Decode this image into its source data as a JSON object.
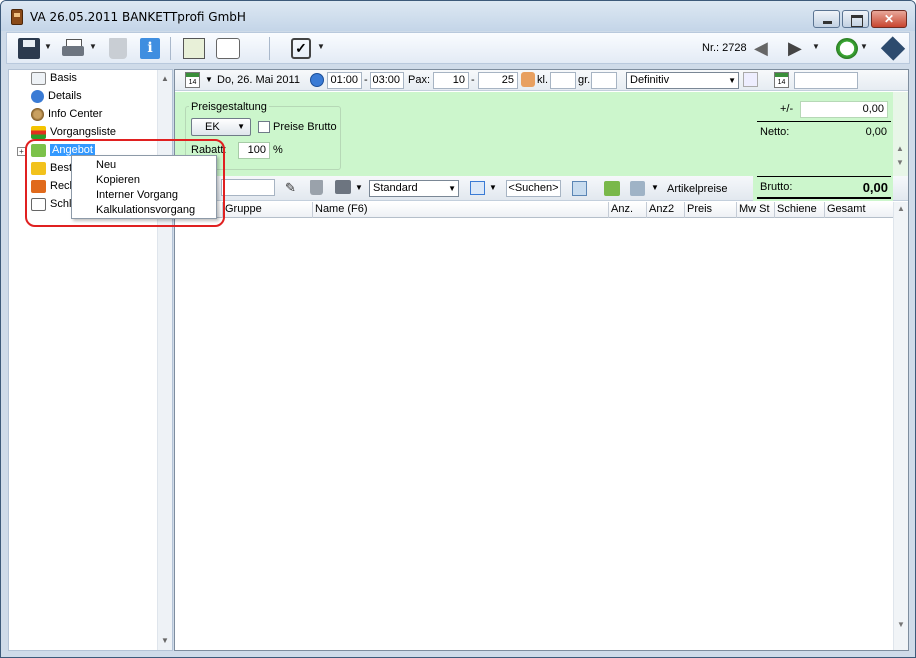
{
  "window": {
    "title": "VA 26.05.2011 BANKETTprofi GmbH",
    "close_glyph": "✕"
  },
  "toolbar": {
    "nr_text": "Nr.: 2728",
    "icons": [
      "save-icon",
      "print-icon",
      "trash-icon",
      "info-icon",
      "calculator-icon",
      "comment-icon",
      "checklist-icon",
      "back-arrow-icon",
      "forward-arrow-icon",
      "clock-icon",
      "help-icon"
    ]
  },
  "sidebar": {
    "items": [
      {
        "label": "Basis",
        "icon": "basis-icon"
      },
      {
        "label": "Details",
        "icon": "details-icon"
      },
      {
        "label": "Info Center",
        "icon": "info-center-icon"
      },
      {
        "label": "Vorgangsliste",
        "icon": "list-icon"
      },
      {
        "label": "Angebot",
        "icon": "puzzle-icon"
      },
      {
        "label": "Best",
        "icon": "puzzle-icon"
      },
      {
        "label": "Rech",
        "icon": "puzzle-icon"
      },
      {
        "label": "Schl",
        "icon": "search-doc-icon"
      }
    ],
    "plus_glyph": "+"
  },
  "context_menu": {
    "items": [
      "Neu",
      "Kopieren",
      "Interner Vorgang",
      "Kalkulationsvorgang"
    ]
  },
  "filterbar": {
    "date": "Do, 26. Mai 2011",
    "time_from": "01:00",
    "time_sep": "-",
    "time_to": "03:00",
    "pax_label": "Pax:",
    "pax_from": "10",
    "pax_sep": "-",
    "pax_to": "25",
    "kl_label": "kl.",
    "gr_label": "gr.",
    "status": "Definitiv",
    "calendar_day": "14"
  },
  "pricing": {
    "legend": "Preisgestaltung",
    "ek_button": "EK",
    "preise_brutto_label": "Preise Brutto",
    "rabatt_label": "Rabatt:",
    "rabatt_value": "100",
    "percent": "%",
    "plus_minus_label": "+/-",
    "plus_minus_value": "0,00",
    "netto_label": "Netto:",
    "netto_value": "0,00",
    "brutto_label": "Brutto:",
    "brutto_value": "0,00"
  },
  "articles_toolbar": {
    "view_select": "Standard",
    "search_button": "<Suchen>",
    "artikelpreise_label": "Artikelpreise"
  },
  "grid": {
    "columns": [
      "Gruppe",
      "Name (F6)",
      "Anz.",
      "Anz2",
      "Preis",
      "Mw St",
      "Schiene",
      "Gesamt"
    ]
  },
  "colors": {
    "accent_green": "#ccf6cc",
    "selection_blue": "#3399ff",
    "highlight_red": "#e02020"
  }
}
